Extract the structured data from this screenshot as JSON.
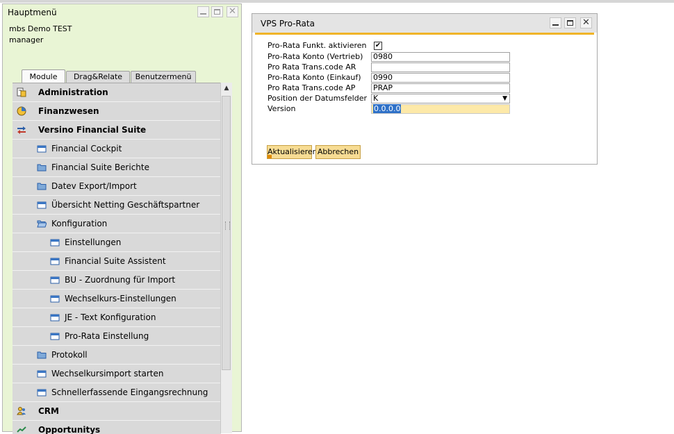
{
  "main_menu": {
    "title": "Hauptmenü",
    "company": "mbs Demo TEST",
    "user": "manager",
    "tabs": [
      "Module",
      "Drag&Relate",
      "Benutzermenü"
    ],
    "items": [
      {
        "label": "Administration",
        "icon": "administration-icon"
      },
      {
        "label": "Finanzwesen",
        "icon": "finance-pie-icon"
      },
      {
        "label": "Versino Financial Suite",
        "icon": "arrows-module-icon"
      },
      {
        "label": "Financial Cockpit",
        "icon": "form-icon"
      },
      {
        "label": "Financial Suite Berichte",
        "icon": "folder-icon"
      },
      {
        "label": "Datev Export/Import",
        "icon": "folder-icon"
      },
      {
        "label": "Übersicht Netting Geschäftspartner",
        "icon": "form-icon"
      },
      {
        "label": "Konfiguration",
        "icon": "folder-open-icon"
      },
      {
        "label": "Einstellungen",
        "icon": "form-icon"
      },
      {
        "label": "Financial Suite Assistent",
        "icon": "form-icon"
      },
      {
        "label": "BU - Zuordnung für Import",
        "icon": "form-icon"
      },
      {
        "label": "Wechselkurs-Einstellungen",
        "icon": "form-icon"
      },
      {
        "label": "JE - Text Konfiguration",
        "icon": "form-icon"
      },
      {
        "label": "Pro-Rata Einstellung",
        "icon": "form-icon"
      },
      {
        "label": "Protokoll",
        "icon": "folder-icon"
      },
      {
        "label": "Wechselkursimport starten",
        "icon": "form-icon"
      },
      {
        "label": "Schnellerfassende Eingangsrechnung",
        "icon": "form-icon"
      },
      {
        "label": "CRM",
        "icon": "crm-people-icon"
      },
      {
        "label": "Opportunitys",
        "icon": "opportunity-icon"
      }
    ]
  },
  "dialog": {
    "title": "VPS Pro-Rata",
    "fields": {
      "activate": {
        "label": "Pro-Rata Funkt. aktivieren",
        "checked": true
      },
      "account_sales": {
        "label": "Pro-Rata Konto (Vertrieb)",
        "value": "0980"
      },
      "transcode_ar": {
        "label": "Pro Rata Trans.code AR",
        "value": ""
      },
      "account_purchase": {
        "label": "Pro-Rata Konto (Einkauf)",
        "value": "0990"
      },
      "transcode_ap": {
        "label": "Pro Rata Trans.code AP",
        "value": "PRAP"
      },
      "date_position": {
        "label": "Position der Datumsfelder",
        "value": "K"
      },
      "version": {
        "label": "Version",
        "value": "0.0.0.0"
      }
    },
    "buttons": {
      "update": "Aktualisieren",
      "cancel": "Abbrechen"
    }
  },
  "colors": {
    "menu_background": "#e9f5d5",
    "dialog_accent": "#f0b428",
    "button_background": "#f7dc94",
    "selection": "#2f71c8"
  }
}
